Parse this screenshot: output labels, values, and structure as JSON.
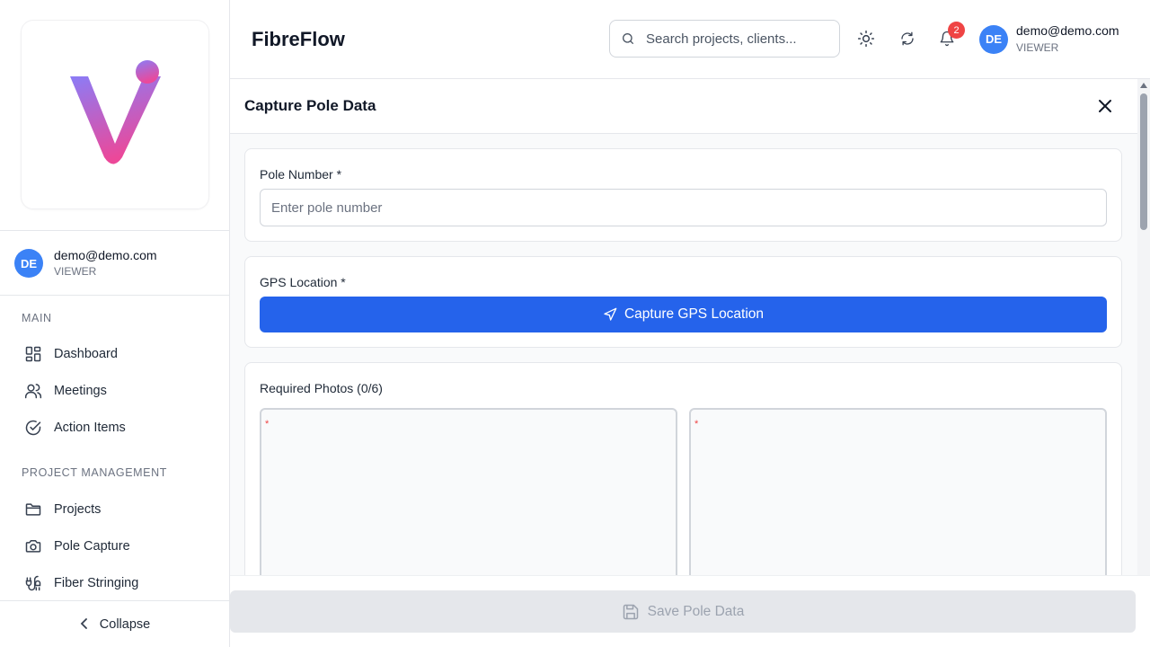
{
  "app": {
    "title": "FibreFlow"
  },
  "brand": {
    "logo_colors": [
      "#8b7cf6",
      "#ec4899"
    ]
  },
  "search": {
    "placeholder": "Search projects, clients..."
  },
  "header": {
    "theme_icon": "sun-icon",
    "refresh_icon": "refresh-icon",
    "notifications_icon": "bell-icon",
    "notifications_count": "2",
    "user": {
      "initials": "DE",
      "email": "demo@demo.com",
      "role": "VIEWER"
    }
  },
  "sidebar": {
    "user": {
      "initials": "DE",
      "email": "demo@demo.com",
      "role": "VIEWER"
    },
    "sections": [
      {
        "label": "MAIN",
        "items": [
          {
            "label": "Dashboard",
            "icon": "dashboard-icon"
          },
          {
            "label": "Meetings",
            "icon": "users-icon"
          },
          {
            "label": "Action Items",
            "icon": "check-circle-icon"
          }
        ]
      },
      {
        "label": "PROJECT MANAGEMENT",
        "items": [
          {
            "label": "Projects",
            "icon": "folder-icon"
          },
          {
            "label": "Pole Capture",
            "icon": "camera-icon"
          },
          {
            "label": "Fiber Stringing",
            "icon": "cable-icon"
          }
        ]
      }
    ],
    "collapse_label": "Collapse"
  },
  "panel": {
    "title": "Capture Pole Data",
    "pole_number": {
      "label": "Pole Number *",
      "placeholder": "Enter pole number",
      "value": ""
    },
    "gps": {
      "label": "GPS Location *",
      "button_label": "Capture GPS Location"
    },
    "photos": {
      "label": "Required Photos (0/6)",
      "required_marker": "*"
    },
    "save_label": "Save Pole Data"
  },
  "colors": {
    "primary": "#2563eb",
    "avatar": "#3b82f6",
    "badge": "#ef4444"
  }
}
